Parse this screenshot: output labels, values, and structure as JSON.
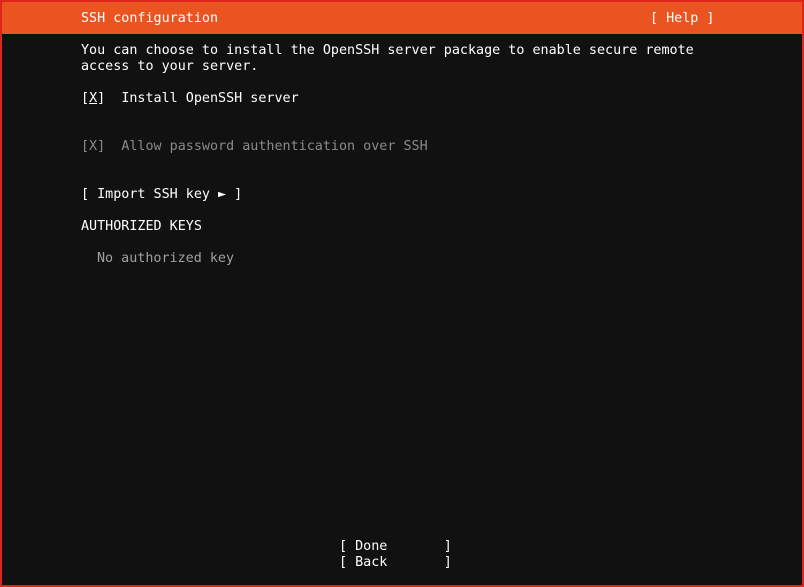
{
  "header": {
    "title": "SSH configuration",
    "help_label": "[ Help ]",
    "background_color": "#e95420"
  },
  "description": {
    "line1": "You can choose to install the OpenSSH server package to enable secure remote",
    "line2": "access to your server."
  },
  "install_openssh": {
    "open_bracket": "[",
    "mark": "X",
    "close_bracket": "]",
    "label": "Install OpenSSH server",
    "checked": true
  },
  "allow_password": {
    "box": "[X]",
    "label": "Allow password authentication over SSH",
    "checked": true,
    "disabled": true
  },
  "import_key": {
    "label": "[ Import SSH key ► ]"
  },
  "authorized_keys": {
    "heading": "AUTHORIZED KEYS",
    "empty_text": "No authorized key"
  },
  "buttons": {
    "done": "[ Done       ]",
    "back": "[ Back       ]"
  },
  "colors": {
    "border": "#e0241b",
    "background": "#111111",
    "disabled_text": "#8a8a8a"
  }
}
